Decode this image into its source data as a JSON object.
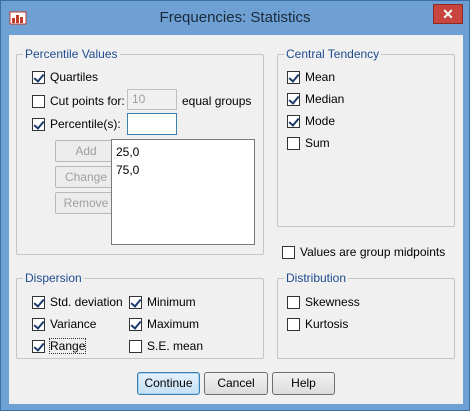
{
  "window": {
    "title": "Frequencies: Statistics",
    "close_label": "✕"
  },
  "percentile_values": {
    "legend": "Percentile Values",
    "quartiles": {
      "label": "Quartiles",
      "checked": true
    },
    "cut_points": {
      "label": "Cut points for:",
      "value": "10",
      "suffix": "equal groups",
      "checked": false
    },
    "percentiles": {
      "label": "Percentile(s):",
      "value": "",
      "checked": true
    },
    "add_label": "Add",
    "change_label": "Change",
    "remove_label": "Remove",
    "list_items": [
      "25,0",
      "75,0"
    ]
  },
  "central_tendency": {
    "legend": "Central Tendency",
    "items": [
      {
        "label": "Mean",
        "checked": true
      },
      {
        "label": "Median",
        "checked": true
      },
      {
        "label": "Mode",
        "checked": true
      },
      {
        "label": "Sum",
        "checked": false
      }
    ]
  },
  "midpoints": {
    "label": "Values are group midpoints",
    "checked": false
  },
  "dispersion": {
    "legend": "Dispersion",
    "items": [
      {
        "label": "Std. deviation",
        "checked": true
      },
      {
        "label": "Minimum",
        "checked": true
      },
      {
        "label": "Variance",
        "checked": true
      },
      {
        "label": "Maximum",
        "checked": true
      },
      {
        "label": "Range",
        "checked": true
      },
      {
        "label": "S.E. mean",
        "checked": false
      }
    ]
  },
  "distribution": {
    "legend": "Distribution",
    "items": [
      {
        "label": "Skewness",
        "checked": false
      },
      {
        "label": "Kurtosis",
        "checked": false
      }
    ]
  },
  "buttons": {
    "continue": "Continue",
    "cancel": "Cancel",
    "help": "Help"
  },
  "colors": {
    "titlebar": "#6ea0d4",
    "close": "#c7453d",
    "legend_text": "#1f4b8e"
  }
}
